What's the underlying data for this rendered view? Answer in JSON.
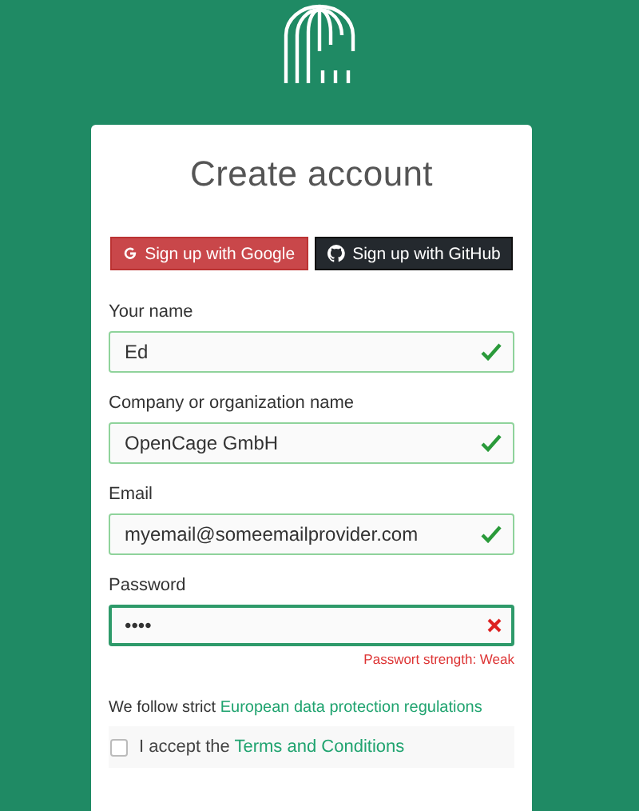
{
  "title": "Create account",
  "social_buttons": [
    {
      "kind": "google",
      "label": "Sign up with Google"
    },
    {
      "kind": "github",
      "label": "Sign up with GitHub"
    }
  ],
  "fields": [
    {
      "label": "Your name",
      "value": "Ed",
      "valid": true,
      "focused": false
    },
    {
      "label": "Company or organization name",
      "value": "OpenCage GmbH",
      "valid": true,
      "focused": false
    },
    {
      "label": "Email",
      "value": "myemail@someemailprovider.com",
      "valid": true,
      "focused": false
    },
    {
      "label": "Password",
      "value": "••••",
      "valid": false,
      "focused": true,
      "error": "Passwort strength: Weak"
    }
  ],
  "privacy": {
    "text": "We follow strict",
    "link": "European data protection regulations"
  },
  "terms": {
    "checked": false,
    "text": "I accept the",
    "link": "Terms and Conditions"
  }
}
